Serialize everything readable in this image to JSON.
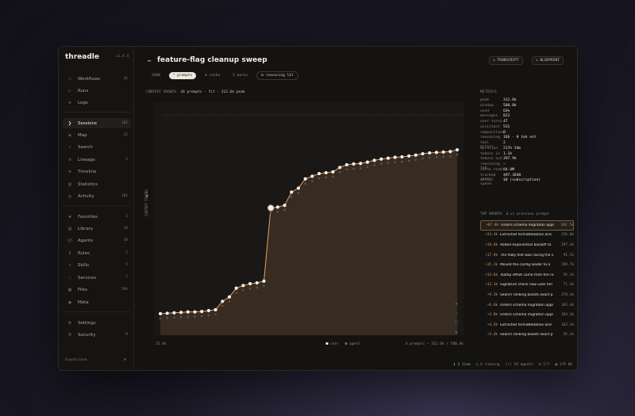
{
  "app": {
    "name": "threadle",
    "version": "v1.8.4"
  },
  "sidebar": {
    "groups": [
      [
        {
          "label": "Workflows",
          "icon": "◇",
          "count": "31"
        },
        {
          "label": "Runs",
          "icon": "▷",
          "count": ""
        },
        {
          "label": "Logs",
          "icon": "≡",
          "count": ""
        }
      ],
      [
        {
          "label": "Sessions",
          "icon": "❯",
          "count": "102",
          "active": true
        },
        {
          "label": "Map",
          "icon": "◈",
          "count": "12"
        },
        {
          "label": "Search",
          "icon": "⌕",
          "count": ""
        },
        {
          "label": "Lineage",
          "icon": "≡",
          "count": "5"
        },
        {
          "label": "Timeline",
          "icon": "≡",
          "count": ""
        },
        {
          "label": "Statistics",
          "icon": "▥",
          "count": ""
        },
        {
          "label": "Activity",
          "icon": "◎",
          "count": "102"
        }
      ],
      [
        {
          "label": "Favorites",
          "icon": "★",
          "count": "2"
        },
        {
          "label": "Library",
          "icon": "▤",
          "count": "19"
        },
        {
          "label": "Agents",
          "icon": "(/)",
          "count": "19"
        },
        {
          "label": "Rules",
          "icon": "§",
          "count": "2"
        },
        {
          "label": "Skills",
          "icon": "⋄",
          "count": "5"
        },
        {
          "label": "Services",
          "icon": "◌",
          "count": "7"
        },
        {
          "label": "Files",
          "icon": "▦",
          "count": "294"
        },
        {
          "label": "Meta",
          "icon": "◉",
          "count": ""
        }
      ],
      [
        {
          "label": "Settings",
          "icon": "⚙",
          "count": ""
        },
        {
          "label": "Security",
          "icon": "⛨",
          "count": "9"
        }
      ]
    ],
    "footer": "Export issue",
    "footer_icon": "⊕"
  },
  "header": {
    "back": "←",
    "title": "feature-flag cleanup sweep",
    "buttons": [
      "⇲ TRANSCRIPT",
      "⇲ BLUEPRINT"
    ]
  },
  "tabs": [
    {
      "label": "SHOW",
      "style": "plain"
    },
    {
      "label": "⁰ prompts",
      "style": "on"
    },
    {
      "label": "⊞ cache",
      "style": "plain"
    },
    {
      "label": "5 marks",
      "style": "plain"
    },
    {
      "label": "⊞ reasoning lbl",
      "style": "ghost"
    }
  ],
  "chart_header": {
    "label": "CONTEXT GROWTH",
    "detail": "44 prompts · fit · 312.6k peak"
  },
  "chart_data": {
    "type": "line",
    "ylabel": "CONTEXT TOKENS",
    "ylim": [
      0,
      500
    ],
    "x_start_label": "15.4k",
    "legend": [
      "user",
      "agent"
    ],
    "footer_note": "X prompts — 312.6k / 500.0k",
    "window_line": 500,
    "series": [
      {
        "values": [
          20,
          21,
          22,
          23,
          24,
          24,
          25,
          27,
          29,
          48,
          58,
          78,
          84,
          88,
          90,
          94,
          260,
          262,
          266,
          296,
          305,
          326,
          332,
          338,
          340,
          342,
          352,
          358,
          360,
          361,
          364,
          368,
          371,
          373,
          375,
          376,
          378,
          380,
          383,
          385,
          386,
          387,
          388,
          392
        ]
      }
    ],
    "highlight_index": 16
  },
  "metrics": {
    "heading": "METRICS",
    "rows": [
      [
        "peak",
        "312.6k"
      ],
      [
        "window",
        "500.0k"
      ],
      [
        "used",
        "63%"
      ],
      [
        "messages",
        "822"
      ],
      [
        "user turns",
        "47"
      ],
      [
        "assistant",
        "531"
      ],
      [
        "compactions",
        "0"
      ],
      [
        "reasoning",
        "166 · 0 tok est"
      ],
      [
        "tool errors",
        "2"
      ],
      [
        "duration",
        "217h 54m"
      ],
      [
        "tokens in",
        "1.1k"
      ],
      [
        "tokens out",
        "397.9k"
      ],
      [
        "reasoning tok",
        "—"
      ],
      [
        "cache read",
        "84.8M"
      ],
      [
        "tracked costs",
        "$97.3640"
      ],
      [
        "actual spend",
        "$0 (subscription)"
      ]
    ]
  },
  "top_growth": {
    "heading": "TOP GROWTH",
    "subheading": "Δ vs previous prompt",
    "rows": [
      {
        "delta": "+87.9k",
        "text": "Orders schema migration appl",
        "total": "188.7k",
        "active": true
      },
      {
        "delta": "+24.4k",
        "text": "Extracted formatRelative and",
        "total": "256.0k"
      },
      {
        "delta": "+19.6k",
        "text": "Added exponential backoff to",
        "total": "297.4k"
      },
      {
        "delta": "+17.9k",
        "text": "The flaky test was racing the s",
        "total": "91.5k"
      },
      {
        "delta": "+15.1k",
        "text": "Moved the config loader to e",
        "total": "289.7k"
      },
      {
        "delta": "+14.6k",
        "text": "Tooltip offset came from the re",
        "total": "95.1k"
      },
      {
        "delta": "+12.1k",
        "text": "Signature check now uses tim",
        "total": "71.3k"
      },
      {
        "delta": "+9.3k",
        "text": "Search ranking boosts exact p",
        "total": "270.4k"
      },
      {
        "delta": "+6.6k",
        "text": "Orders schema migration appl",
        "total": "303.4k"
      },
      {
        "delta": "+4.8k",
        "text": "Orders schema migration appl",
        "total": "283.3k"
      },
      {
        "delta": "+4.5k",
        "text": "Extracted formatRelative and",
        "total": "303.2k"
      },
      {
        "delta": "+3.4k",
        "text": "Search ranking boosts exact p",
        "total": "95.1k"
      }
    ]
  },
  "status": {
    "live": "❯ 1 live",
    "running": "◎ 6 running",
    "agents": "(/) 19 agents",
    "checks": "⊞ 7/7",
    "tokens": "▣ 279 00"
  },
  "colors": {
    "accent": "#d9985c",
    "area": "#3d2f24",
    "line": "#e8a060",
    "bg": "#141312"
  }
}
